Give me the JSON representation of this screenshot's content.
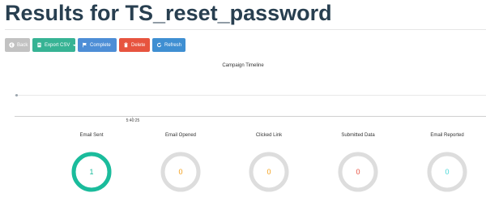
{
  "page": {
    "title": "Results for TS_reset_password"
  },
  "toolbar": {
    "back_label": "Back",
    "export_label": "Export CSV",
    "complete_label": "Complete",
    "delete_label": "Delete",
    "refresh_label": "Refresh"
  },
  "timeline": {
    "title": "Campaign Timeline",
    "tick_label": "5:40:25"
  },
  "stats": [
    {
      "label": "Email Sent",
      "value": "1",
      "fraction": 1.0,
      "color": "#1abc9c"
    },
    {
      "label": "Email Opened",
      "value": "0",
      "fraction": 0.0,
      "color": "#f39c12"
    },
    {
      "label": "Clicked Link",
      "value": "0",
      "fraction": 0.0,
      "color": "#f39c12"
    },
    {
      "label": "Submitted Data",
      "value": "0",
      "fraction": 0.0,
      "color": "#e74c3c"
    },
    {
      "label": "Email Reported",
      "value": "0",
      "fraction": 0.0,
      "color": "#45d6d6"
    }
  ],
  "colors": {
    "title": "#283f50",
    "ring_track": "#dddddd"
  }
}
